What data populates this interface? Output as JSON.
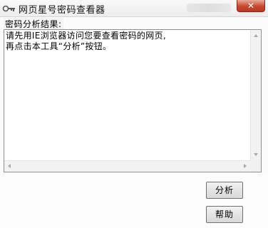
{
  "window": {
    "title": "网页星号密码查看器",
    "close_label": "✕",
    "app_icon": "key-icon"
  },
  "result": {
    "label": "密码分析结果:",
    "text": "请先用IE浏览器访问您要查看密码的网页,\n再点击本工具“分析”按钮。"
  },
  "buttons": {
    "analyze_label": "分析",
    "help_label": "帮助"
  },
  "colors": {
    "close_button": "#c8472f",
    "window_bg": "#fbfbfb"
  }
}
